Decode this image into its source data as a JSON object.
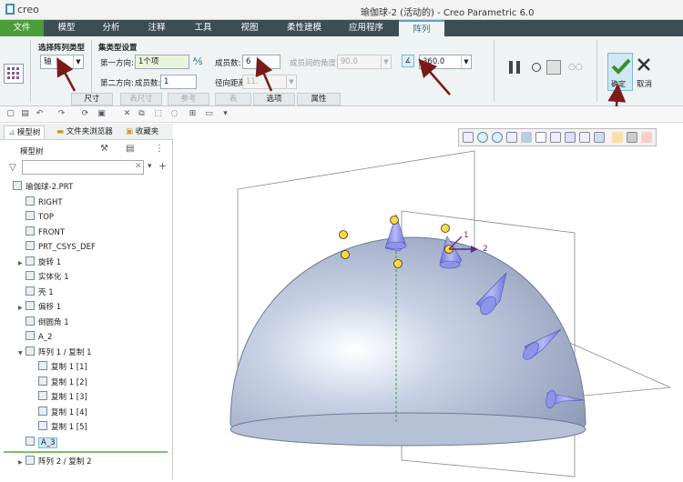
{
  "window": {
    "app_name": "creo",
    "title": "瑜伽球-2 (活动的) - Creo Parametric 6.0"
  },
  "menu": {
    "tabs": [
      "文件",
      "模型",
      "分析",
      "注释",
      "工具",
      "视图",
      "柔性建模",
      "应用程序",
      "阵列"
    ],
    "active": "阵列"
  },
  "ribbon": {
    "pattern_type_label": "选择阵列类型",
    "pattern_type_value": "轴",
    "set_type_label": "集类型设置",
    "dir1_label": "第一方向:",
    "dir1_value": "1个项",
    "dir2_label": "第二方向:",
    "dir2_count_label": "成员数:",
    "dir2_count_value": "1",
    "members_label": "成员数:",
    "members_value": "6",
    "radial_label": "径向距离:",
    "radial_value": "11.",
    "angle_between_label": "成员间的角度:",
    "angle_between_value": "90.0",
    "angle_total_value": "360.0",
    "confirm_label": "确定",
    "cancel_label": "取消",
    "subtabs": [
      "尺寸",
      "表尺寸",
      "参考",
      "表",
      "选项",
      "属性"
    ]
  },
  "left_panel": {
    "tabs": [
      "模型树",
      "文件夹浏览器",
      "收藏夹"
    ],
    "tree_header": "模型树",
    "search_placeholder": "",
    "tree": [
      {
        "label": "瑜伽球-2.PRT",
        "indent": 0,
        "expand": ""
      },
      {
        "label": "RIGHT",
        "indent": 1,
        "expand": ""
      },
      {
        "label": "TOP",
        "indent": 1,
        "expand": ""
      },
      {
        "label": "FRONT",
        "indent": 1,
        "expand": ""
      },
      {
        "label": "PRT_CSYS_DEF",
        "indent": 1,
        "expand": ""
      },
      {
        "label": "旋转 1",
        "indent": 1,
        "expand": "▶"
      },
      {
        "label": "实体化 1",
        "indent": 1,
        "expand": ""
      },
      {
        "label": "壳 1",
        "indent": 1,
        "expand": ""
      },
      {
        "label": "偏移 1",
        "indent": 1,
        "expand": "▶"
      },
      {
        "label": "倒圆角 1",
        "indent": 1,
        "expand": ""
      },
      {
        "label": "A_2",
        "indent": 1,
        "expand": ""
      },
      {
        "label": "阵列 1 / 复制 1",
        "indent": 1,
        "expand": "▼"
      },
      {
        "label": "复制 1 [1]",
        "indent": 2,
        "expand": ""
      },
      {
        "label": "复制 1 [2]",
        "indent": 2,
        "expand": ""
      },
      {
        "label": "复制 1 [3]",
        "indent": 2,
        "expand": ""
      },
      {
        "label": "复制 1 [4]",
        "indent": 2,
        "expand": ""
      },
      {
        "label": "复制 1 [5]",
        "indent": 2,
        "expand": ""
      },
      {
        "label": "A_3",
        "indent": 1,
        "expand": "",
        "selected": true
      },
      {
        "label": "阵列 2 / 复制 2",
        "indent": 1,
        "expand": "▶"
      }
    ]
  },
  "viewport": {
    "axis_labels": [
      "1",
      "2"
    ]
  },
  "colors": {
    "menubar": "#3d4d54",
    "file_tab": "#4b9c3a",
    "model_fill": "#b4c0d8",
    "spike": "#8d95e8",
    "arrow": "#7a1a1a"
  }
}
